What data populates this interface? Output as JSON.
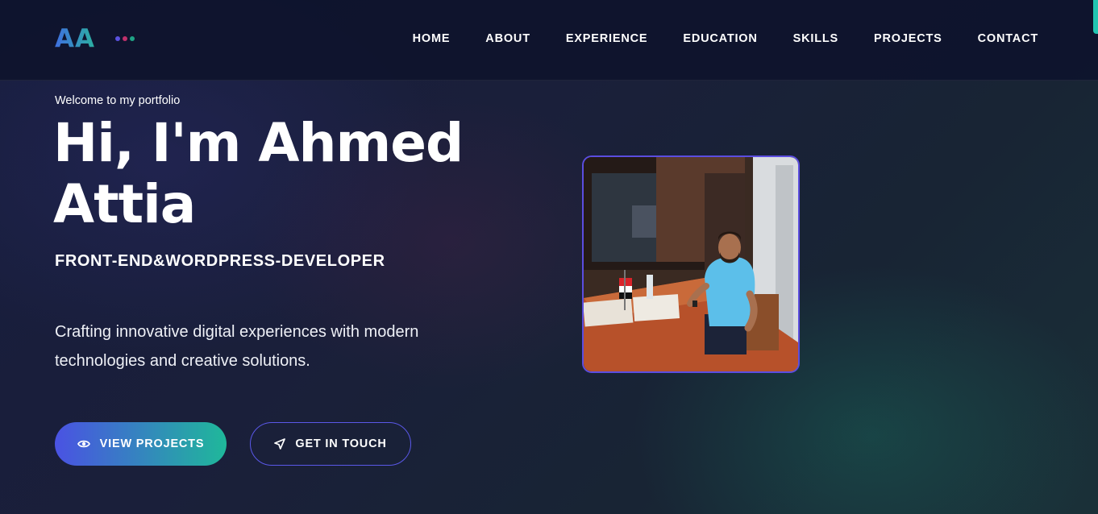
{
  "header": {
    "logo": "AA",
    "logo_dots": [
      "#5a52e0",
      "#c0306b",
      "#1fa386"
    ],
    "nav": [
      "HOME",
      "ABOUT",
      "EXPERIENCE",
      "EDUCATION",
      "SKILLS",
      "PROJECTS",
      "CONTACT"
    ]
  },
  "hero": {
    "welcome": "Welcome to my portfolio",
    "name_line1": "Hi, I'm Ahmed",
    "name_line2": "Attia",
    "role": "FRONT-END&WORDPRESS-DEVELOPER",
    "desc_line1": "Crafting innovative digital experiences with modern",
    "desc_line2": "technologies and creative solutions.",
    "primary_button": {
      "label": "VIEW PROJECTS",
      "icon": "eye-icon"
    },
    "secondary_button": {
      "label": "GET IN TOUCH",
      "icon": "send-icon"
    }
  },
  "colors": {
    "accent_indigo": "#5a52e0",
    "accent_teal": "#1fb89a",
    "background": "#141c33"
  }
}
